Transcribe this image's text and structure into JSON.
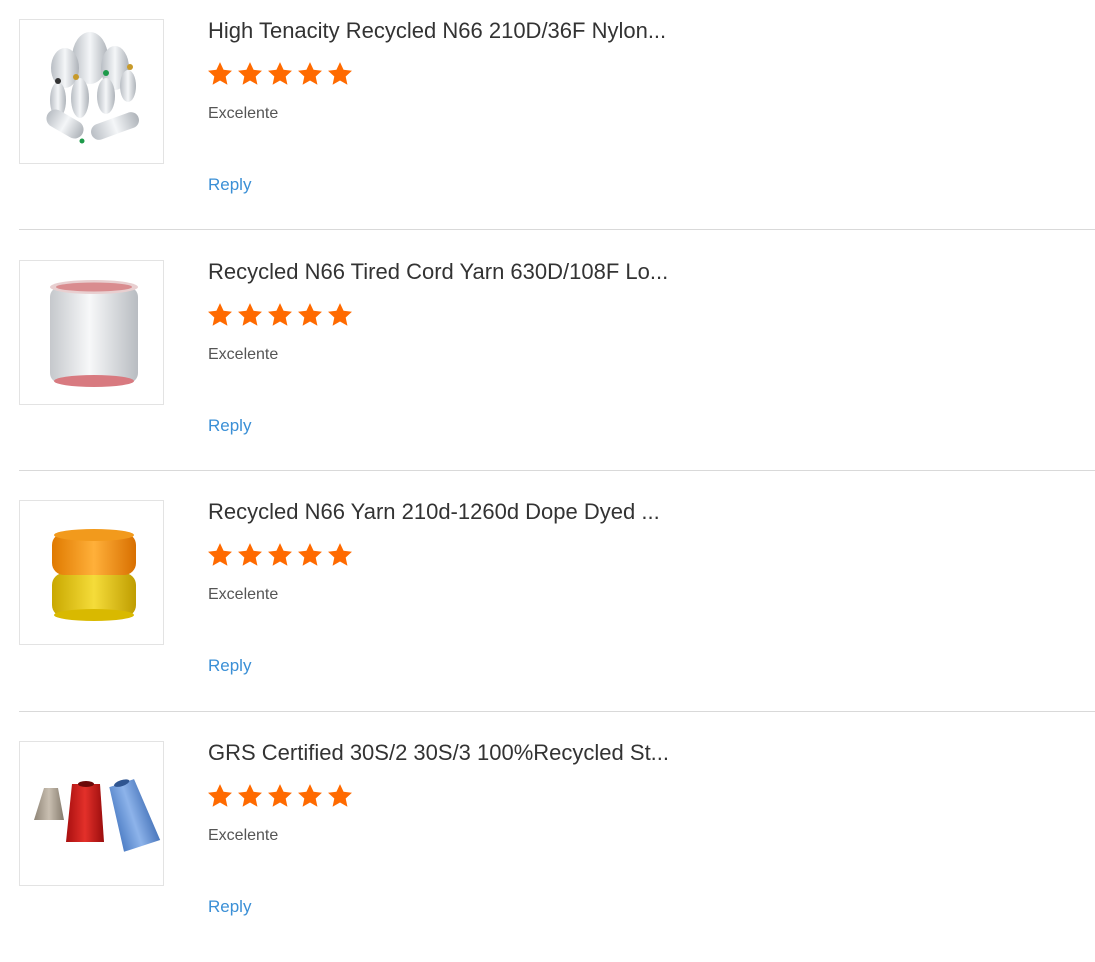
{
  "reviews": [
    {
      "title": "High Tenacity Recycled N66 210D/36F Nylon...",
      "rating": 5,
      "rating_max": 5,
      "rating_text": "Excelente",
      "reply_label": "Reply",
      "image_icon": "white-yarn-bobbins-icon"
    },
    {
      "title": "Recycled N66 Tired Cord Yarn 630D/108F Lo...",
      "rating": 5,
      "rating_max": 5,
      "rating_text": "Excelente",
      "reply_label": "Reply",
      "image_icon": "white-yarn-spool-icon"
    },
    {
      "title": "Recycled N66 Yarn 210d-1260d Dope Dyed ...",
      "rating": 5,
      "rating_max": 5,
      "rating_text": "Excelente",
      "reply_label": "Reply",
      "image_icon": "orange-yellow-yarn-spools-icon"
    },
    {
      "title": "GRS Certified 30S/2 30S/3 100%Recycled St...",
      "rating": 5,
      "rating_max": 5,
      "rating_text": "Excelente",
      "reply_label": "Reply",
      "image_icon": "thread-cones-icon"
    }
  ],
  "colors": {
    "star": "#ff6a00",
    "link": "#3a8fd6",
    "title": "#333333",
    "divider": "#d9d9d9"
  }
}
